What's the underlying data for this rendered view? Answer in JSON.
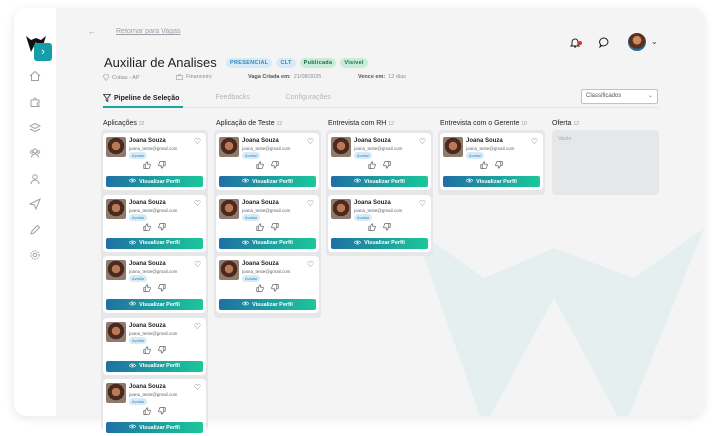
{
  "header": {
    "back_label": "Retornar para Vagas",
    "job_title": "Auxiliar de Analises",
    "tags": [
      "PRESENCIAL",
      "CLT",
      "Publicada",
      "Visível"
    ],
    "location": "Cutias - AP",
    "department": "Financeiro",
    "created_label": "Vaga Criada em:",
    "created_value": "21/08/2025",
    "expires_label": "Vence em:",
    "expires_value": "12 dias"
  },
  "tabs": [
    "Pipeline de Seleção",
    "Feedbacks",
    "Configurações"
  ],
  "filter": {
    "selected": "Classificados"
  },
  "columns": [
    {
      "title": "Aplicações",
      "count": "32"
    },
    {
      "title": "Aplicação de Teste",
      "count": "12"
    },
    {
      "title": "Entrevista com RH",
      "count": "12"
    },
    {
      "title": "Entrevista com o Gerente",
      "count": "10"
    },
    {
      "title": "Oferta",
      "count": "12"
    }
  ],
  "empty_label": "Vazio",
  "candidate": {
    "name": "Joana Souza",
    "email": "joana_teste@gmail.com",
    "badge": "Avaliar",
    "button": "Visualizar Perfil"
  },
  "icons": {
    "sidebar": [
      "home-icon",
      "puzzle-icon",
      "layers-icon",
      "users-icon",
      "user-icon",
      "send-icon",
      "pen-icon",
      "gear-icon"
    ],
    "header": [
      "bell-icon",
      "chat-icon"
    ]
  },
  "colors": {
    "accent": "#169ea8",
    "button_start": "#1f70a5",
    "button_end": "#1cc79a",
    "notification": "#e0342b"
  }
}
